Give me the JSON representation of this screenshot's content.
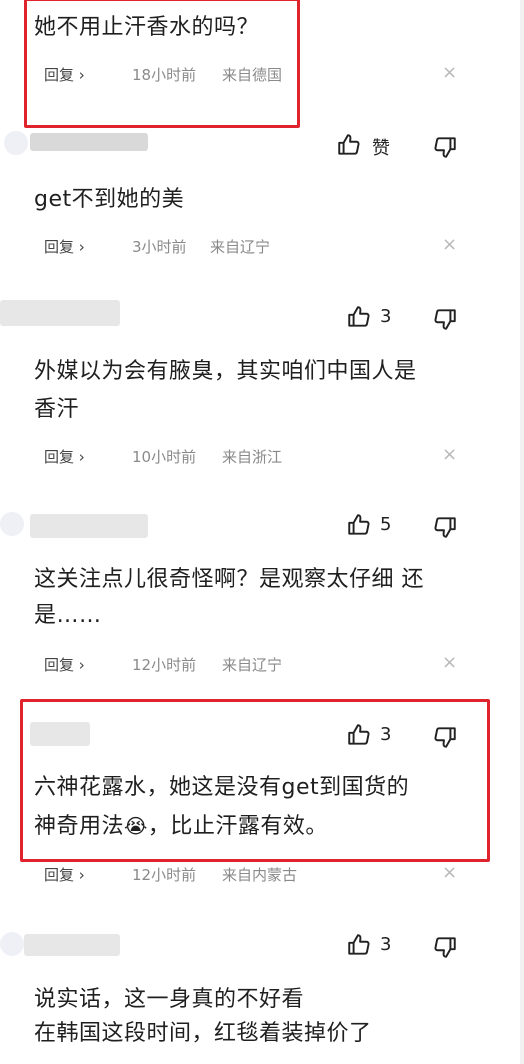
{
  "comments": [
    {
      "text": "她不用止汗香水的吗？",
      "reply": "回复 ›",
      "time": "18小时前",
      "location": "来自德国",
      "close": "×"
    },
    {
      "text": "get不到她的美",
      "reply": "回复 ›",
      "time": "3小时前",
      "location": "来自辽宁",
      "close": "×"
    },
    {
      "text_line1": "外媒以为会有腋臭，其实咱们中国人是",
      "text_line2": "香汗",
      "reply": "回复 ›",
      "time": "10小时前",
      "location": "来自浙江",
      "close": "×"
    },
    {
      "text_line1": "这关注点儿很奇怪啊？是观察太仔细 还",
      "text_line2": "是……",
      "reply": "回复 ›",
      "time": "12小时前",
      "location": "来自辽宁",
      "close": "×"
    },
    {
      "text_line1": "六神花露水，她这是没有get到国货的",
      "text_line2a": "神奇用法",
      "emoji": "😭",
      "text_line2b": "，比止汗露有效。",
      "reply": "回复 ›",
      "time": "12小时前",
      "location": "来自内蒙古",
      "close": "×"
    },
    {
      "text_line1": "说实话，这一身真的不好看",
      "text_line2": "在韩国这段时间，红毯着装掉价了"
    }
  ],
  "likes": {
    "row1_label": "赞",
    "row2_count": "3",
    "row3_count": "5",
    "row4_count": "3",
    "row5_count": "3"
  },
  "icons": [
    "thumbs-up-icon",
    "thumbs-down-icon",
    "close-icon"
  ],
  "colors": {
    "highlight": "#e0242e",
    "text": "#1f1f1f",
    "meta": "#8a8a8a"
  }
}
